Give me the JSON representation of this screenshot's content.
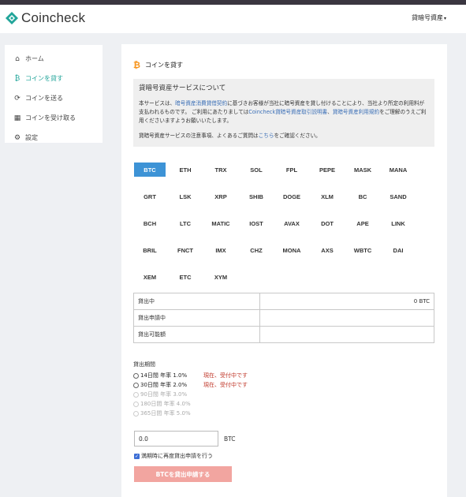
{
  "header": {
    "brand": "Coincheck",
    "account_menu": "貸暗号資産",
    "account_caret": "▾",
    "brand_color": "#22a59a"
  },
  "sidebar": {
    "items": [
      {
        "icon": "home-icon",
        "glyph": "⌂",
        "label": "ホーム",
        "active": false
      },
      {
        "icon": "bitcoin-icon",
        "glyph": "₿",
        "label": "コインを貸す",
        "active": true
      },
      {
        "icon": "send-icon",
        "glyph": "⟳",
        "label": "コインを送る",
        "active": false
      },
      {
        "icon": "qr-icon",
        "glyph": "▦",
        "label": "コインを受け取る",
        "active": false
      },
      {
        "icon": "gear-icon",
        "glyph": "⚙",
        "label": "設定",
        "active": false
      }
    ]
  },
  "main": {
    "title": "コインを貸す",
    "title_icon": "₿",
    "notice": {
      "title": "貸暗号資産サービスについて",
      "body_1": "本サービスは、",
      "body_link_1": "暗号資産消費貸借契約",
      "body_2": "に基づきお客様が当社に暗号資産を貸し付けることにより、当社より所定の利用料が支払われるものです。 ご利用にあたりましては",
      "body_link_2": "Coincheck貸暗号資産取引説明書",
      "body_3": "、",
      "body_link_3": "貸暗号資産利用規約",
      "body_4": "をご理解のうえご利用くださいますようお願いいたします。",
      "contact_1": "貸暗号資産サービスの注意事項、よくあるご質問は",
      "contact_link": "こちら",
      "contact_2": "をご確認ください。"
    },
    "coins": [
      [
        "BTC",
        "ETH",
        "TRX",
        "SOL",
        "FPL",
        "PEPE",
        "MASK",
        "MANA"
      ],
      [
        "GRT",
        "LSK",
        "XRP",
        "SHIB",
        "DOGE",
        "XLM",
        "BC",
        "SAND"
      ],
      [
        "BCH",
        "LTC",
        "MATIC",
        "IOST",
        "AVAX",
        "DOT",
        "APE",
        "LINK"
      ],
      [
        "BRIL",
        "FNCT",
        "IMX",
        "CHZ",
        "MONA",
        "AXS",
        "WBTC",
        "DAI"
      ],
      [
        "XEM",
        "ETC",
        "XYM"
      ]
    ],
    "selected_coin": "BTC",
    "stats": [
      {
        "label": "貸出中",
        "value": "0 BTC"
      },
      {
        "label": "貸出申請中",
        "value": ""
      },
      {
        "label": "貸出可能額",
        "value": ""
      }
    ],
    "period_label": "貸出期間",
    "periods": [
      {
        "text": "14日間 年率 1.0%",
        "status": "現在、受付中です",
        "enabled": true
      },
      {
        "text": "30日間 年率 2.0%",
        "status": "現在、受付中です",
        "enabled": true
      },
      {
        "text": "90日間 年率 3.0%",
        "status": "",
        "enabled": false
      },
      {
        "text": "180日間 年率 4.0%",
        "status": "",
        "enabled": false
      },
      {
        "text": "365日間 年率 5.0%",
        "status": "",
        "enabled": false
      }
    ],
    "amount_value": "0.0",
    "amount_unit": "BTC",
    "auto_renew_label": "満期時に再度貸出申請を行う",
    "auto_renew_checked": true,
    "submit_label": "BTCを貸出申請する",
    "submit_color": "#f2a5a0",
    "selected_color": "#3d93d6"
  }
}
